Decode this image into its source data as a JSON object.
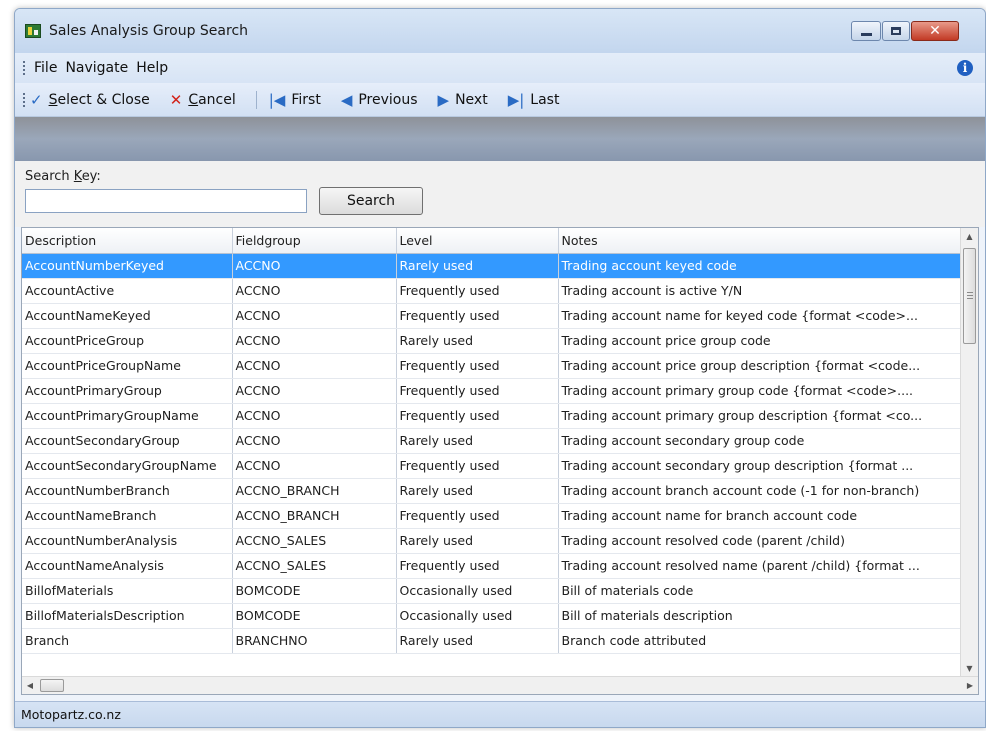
{
  "window": {
    "title": "Sales Analysis Group Search",
    "minimize_symbol": "",
    "close_symbol": "✕"
  },
  "menu": {
    "items": [
      "File",
      "Navigate",
      "Help"
    ],
    "info_symbol": "i"
  },
  "toolbar": {
    "select_close": {
      "access_key": "S",
      "rest": "elect & Close",
      "icon": "check-icon"
    },
    "cancel": {
      "access_key": "C",
      "rest": "ancel",
      "icon": "x-icon"
    },
    "first": "First",
    "previous": "Previous",
    "next": "Next",
    "last": "Last"
  },
  "search": {
    "label_prefix": "Search ",
    "label_access_key": "K",
    "label_suffix": "ey:",
    "value": "",
    "button_label": "Search"
  },
  "table": {
    "columns": [
      "Description",
      "Fieldgroup",
      "Level",
      "Notes"
    ],
    "selected_row": 0,
    "rows": [
      [
        "AccountNumberKeyed",
        "ACCNO",
        "Rarely used",
        "Trading account keyed code"
      ],
      [
        "AccountActive",
        "ACCNO",
        "Frequently used",
        "Trading account is active Y/N"
      ],
      [
        "AccountNameKeyed",
        "ACCNO",
        "Frequently used",
        "Trading account name for keyed code {format  <code>..."
      ],
      [
        "AccountPriceGroup",
        "ACCNO",
        "Rarely used",
        "Trading account price group code"
      ],
      [
        "AccountPriceGroupName",
        "ACCNO",
        "Frequently used",
        "Trading account price group description {format  <code..."
      ],
      [
        "AccountPrimaryGroup",
        "ACCNO",
        "Frequently used",
        "Trading account primary group code {format  <code>...."
      ],
      [
        "AccountPrimaryGroupName",
        "ACCNO",
        "Frequently used",
        "Trading account primary group description {format  <co..."
      ],
      [
        "AccountSecondaryGroup",
        "ACCNO",
        "Rarely used",
        "Trading account secondary group code"
      ],
      [
        "AccountSecondaryGroupName",
        "ACCNO",
        "Frequently used",
        "Trading account secondary group description {format  ..."
      ],
      [
        "AccountNumberBranch",
        "ACCNO_BRANCH",
        "Rarely used",
        "Trading account branch account code (-1 for non-branch)"
      ],
      [
        "AccountNameBranch",
        "ACCNO_BRANCH",
        "Frequently used",
        "Trading account name for branch account code"
      ],
      [
        "AccountNumberAnalysis",
        "ACCNO_SALES",
        "Rarely used",
        "Trading account resolved code (parent /child)"
      ],
      [
        "AccountNameAnalysis",
        "ACCNO_SALES",
        "Frequently used",
        "Trading account resolved name (parent /child)  {format ..."
      ],
      [
        "BillofMaterials",
        "BOMCODE",
        "Occasionally used",
        "Bill of materials code"
      ],
      [
        "BillofMaterialsDescription",
        "BOMCODE",
        "Occasionally used",
        "Bill of materials description"
      ],
      [
        "Branch",
        "BRANCHNO",
        "Rarely used",
        "Branch code attributed"
      ]
    ]
  },
  "statusbar": {
    "text": "Motopartz.co.nz"
  },
  "colors": {
    "selection": "#3399ff",
    "cancel_icon": "#d2231a",
    "nav_icon": "#2a6bc4"
  }
}
